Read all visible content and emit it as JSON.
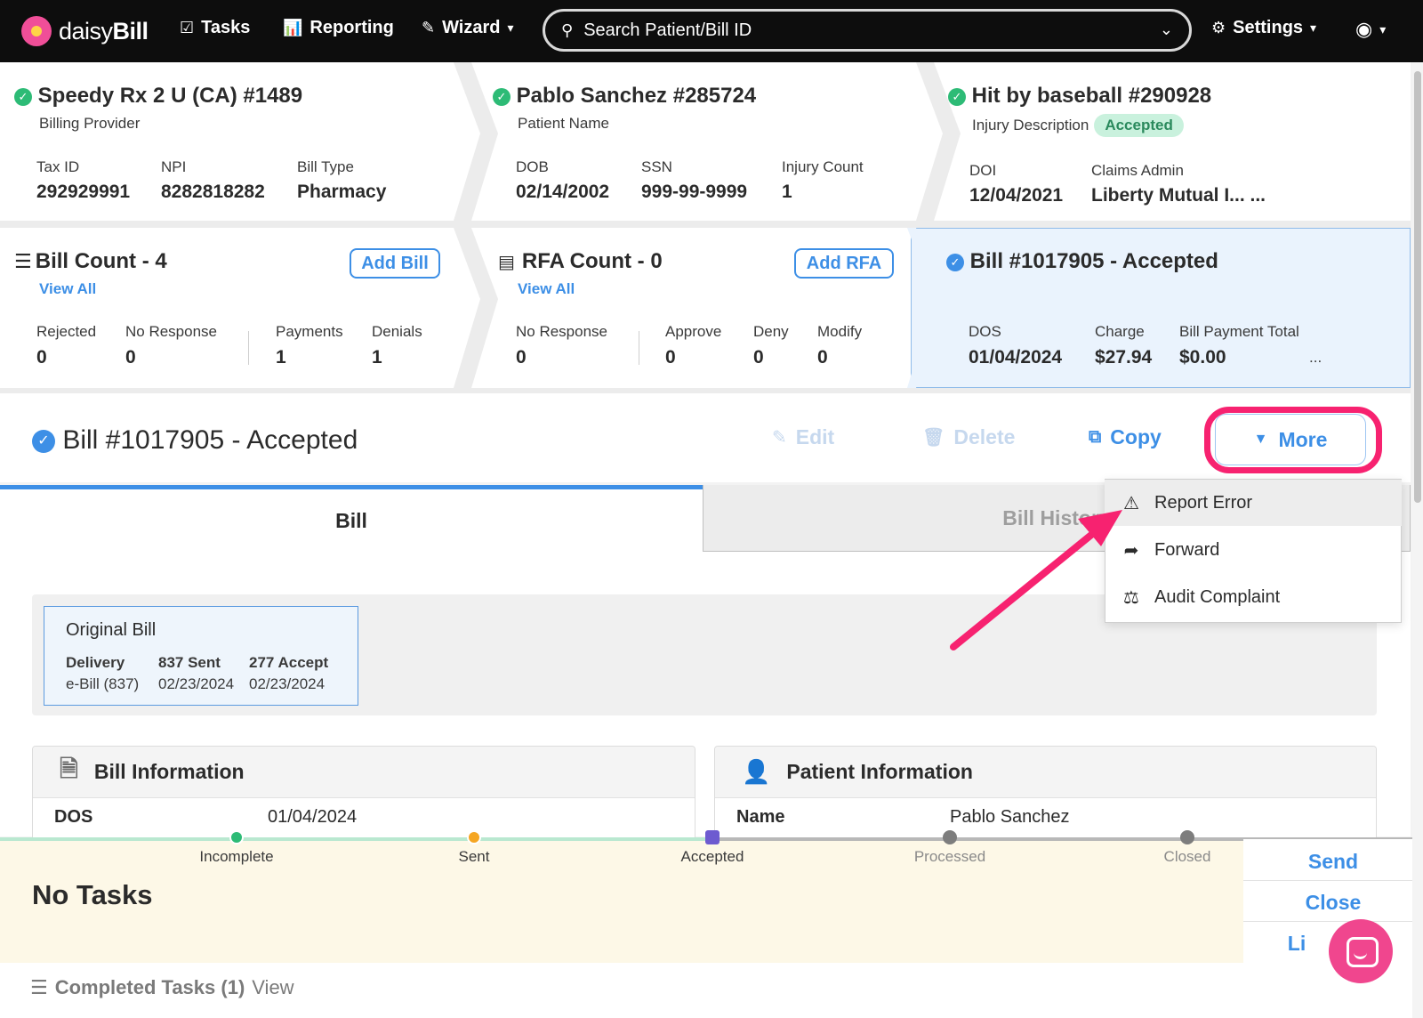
{
  "nav": {
    "brand_light": "daisy",
    "brand_bold": "Bill",
    "tasks": "Tasks",
    "reporting": "Reporting",
    "wizard": "Wizard",
    "search_placeholder": "Search Patient/Bill ID",
    "settings": "Settings"
  },
  "provider": {
    "title": "Speedy Rx 2 U (CA) #1489",
    "subtitle": "Billing Provider",
    "fields": [
      {
        "label": "Tax ID",
        "value": "292929991"
      },
      {
        "label": "NPI",
        "value": "8282818282"
      },
      {
        "label": "Bill Type",
        "value": "Pharmacy"
      }
    ]
  },
  "patient": {
    "title": "Pablo Sanchez #285724",
    "subtitle": "Patient Name",
    "fields": [
      {
        "label": "DOB",
        "value": "02/14/2002"
      },
      {
        "label": "SSN",
        "value": "999-99-9999"
      },
      {
        "label": "Injury Count",
        "value": "1"
      }
    ]
  },
  "injury": {
    "title": "Hit by baseball #290928",
    "subtitle": "Injury Description",
    "badge": "Accepted",
    "fields": [
      {
        "label": "DOI",
        "value": "12/04/2021"
      },
      {
        "label": "Claims Admin",
        "value": "Liberty Mutual I... ..."
      }
    ]
  },
  "bill_count": {
    "title": "Bill Count - 4",
    "view_all": "View All",
    "add_button": "Add Bill",
    "fields": [
      {
        "label": "Rejected",
        "value": "0"
      },
      {
        "label": "No Response",
        "value": "0"
      },
      {
        "label": "Payments",
        "value": "1"
      },
      {
        "label": "Denials",
        "value": "1"
      }
    ]
  },
  "rfa_count": {
    "title": "RFA Count - 0",
    "view_all": "View All",
    "add_button": "Add RFA",
    "fields": [
      {
        "label": "No Response",
        "value": "0"
      },
      {
        "label": "Approve",
        "value": "0"
      },
      {
        "label": "Deny",
        "value": "0"
      },
      {
        "label": "Modify",
        "value": "0"
      }
    ]
  },
  "bill_summary": {
    "title": "Bill #1017905 - Accepted",
    "fields": [
      {
        "label": "DOS",
        "value": "01/04/2024"
      },
      {
        "label": "Charge",
        "value": "$27.94"
      },
      {
        "label": "Bill Payment Total",
        "value": "$0.00"
      }
    ],
    "ellipsis": "..."
  },
  "bill_header": {
    "title": "Bill #1017905 - Accepted",
    "edit": "Edit",
    "delete": "Delete",
    "copy": "Copy",
    "more": "More"
  },
  "tabs": {
    "bill": "Bill",
    "history": "Bill History"
  },
  "more_menu": [
    {
      "label": "Report Error",
      "icon": "warning-icon"
    },
    {
      "label": "Forward",
      "icon": "forward-arrow-icon"
    },
    {
      "label": "Audit Complaint",
      "icon": "scales-icon"
    }
  ],
  "original_bill": {
    "title": "Original Bill",
    "columns": [
      {
        "label": "Delivery",
        "value": "e-Bill (837)"
      },
      {
        "label": "837 Sent",
        "value": "02/23/2024"
      },
      {
        "label": "277 Accept",
        "value": "02/23/2024"
      }
    ]
  },
  "bill_info": {
    "title": "Bill Information",
    "dos_label": "DOS",
    "dos_value": "01/04/2024"
  },
  "patient_info": {
    "title": "Patient Information",
    "name_label": "Name",
    "name_value": "Pablo Sanchez"
  },
  "status": {
    "stages": [
      "Incomplete",
      "Sent",
      "Accepted",
      "Processed",
      "Closed"
    ],
    "no_tasks": "No Tasks",
    "completed_tasks": "Completed Tasks (1)",
    "view": "View"
  },
  "side_actions": {
    "send": "Send",
    "close": "Close",
    "third": "Li"
  },
  "colors": {
    "accent": "#3d8fe6",
    "success": "#2dbb76",
    "highlight": "#f72270"
  }
}
